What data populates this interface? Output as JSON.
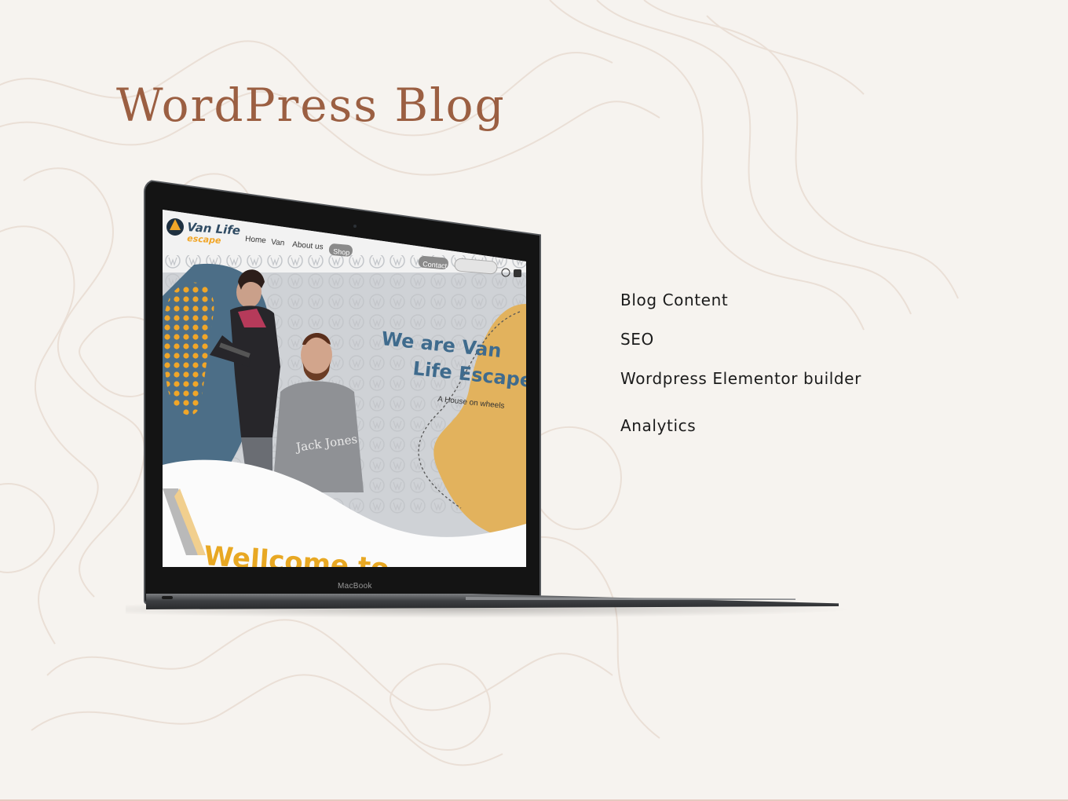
{
  "page": {
    "title": "WordPress Blog"
  },
  "services": [
    "Blog Content",
    "SEO",
    "Wordpress Elementor builder",
    "Analytics"
  ],
  "laptop": {
    "brand_label": "MacBook"
  },
  "website": {
    "logo_line1": "Van Life",
    "logo_line2": "escape",
    "nav": {
      "home": "Home",
      "van": "Van",
      "about": "About us",
      "shop": "Shop"
    },
    "contact_button": "Contact",
    "hero_heading_line1": "We are Van",
    "hero_heading_line2": "Life Escape",
    "hero_tagline": "A House on wheels",
    "welcome_text": "Wellcome to",
    "shirt_text": "Jack Jones"
  },
  "colors": {
    "title": "#9b5f42",
    "background": "#f6f3ef",
    "blob_orange": "#e2b25d",
    "blob_blue": "#4c6e87",
    "heading_blue": "#3f6b8d",
    "dots_orange": "#f1a628"
  }
}
